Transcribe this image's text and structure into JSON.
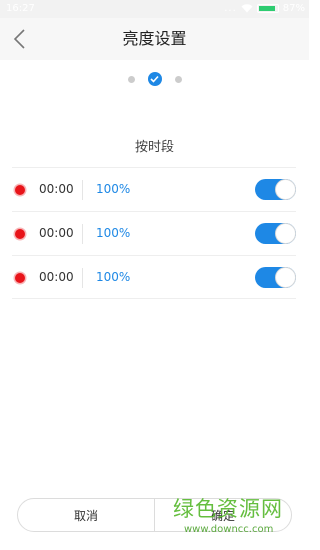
{
  "status_bar": {
    "time": "16:27",
    "signal_dots": "...",
    "battery_percent": "87%"
  },
  "header": {
    "title": "亮度设置",
    "back_icon": "chevron-left-icon"
  },
  "steps": {
    "count": 3,
    "active_index": 1
  },
  "section": {
    "label": "按时段"
  },
  "schedule": [
    {
      "time": "00:00",
      "brightness": "100%",
      "enabled": true
    },
    {
      "time": "00:00",
      "brightness": "100%",
      "enabled": true
    },
    {
      "time": "00:00",
      "brightness": "100%",
      "enabled": true
    }
  ],
  "buttons": {
    "cancel": "取消",
    "confirm": "确定"
  },
  "watermark": {
    "main": "绿色资源网",
    "url": "www.downcc.com"
  },
  "colors": {
    "accent": "#1e88e5",
    "dot_red": "#e8141a",
    "watermark_green": "#55b82b"
  }
}
